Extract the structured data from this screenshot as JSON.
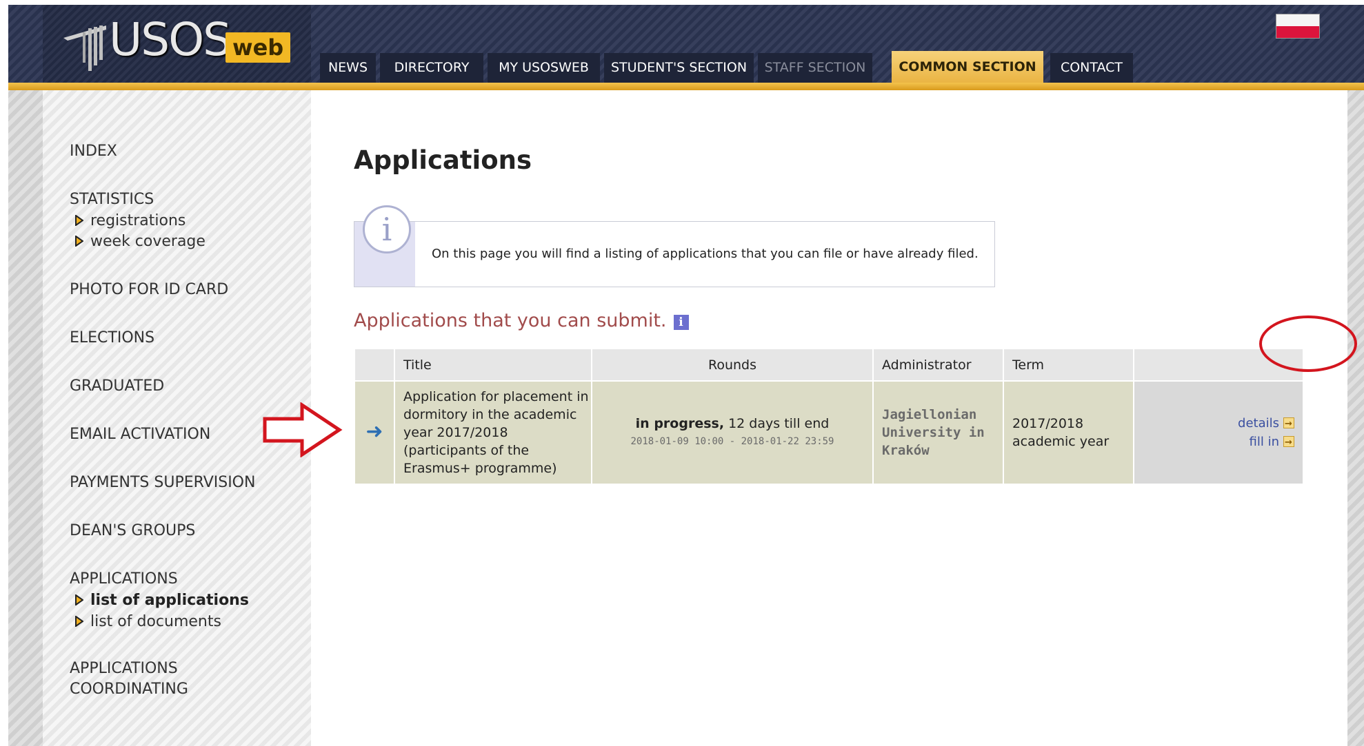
{
  "brand": {
    "logo_text": "USOS",
    "logo_badge": "web"
  },
  "header": {
    "flag": "polish-flag-icon",
    "tabs": [
      {
        "label": "NEWS",
        "state": "normal"
      },
      {
        "label": "DIRECTORY",
        "state": "normal"
      },
      {
        "label": "MY USOSWEB",
        "state": "normal"
      },
      {
        "label": "STUDENT'S SECTION",
        "state": "normal"
      },
      {
        "label": "STAFF SECTION",
        "state": "disabled"
      },
      {
        "label": "COMMON SECTION",
        "state": "active"
      },
      {
        "label": "CONTACT",
        "state": "normal"
      }
    ]
  },
  "sidebar": {
    "index": "INDEX",
    "statistics": "STATISTICS",
    "statistics_items": [
      "registrations",
      "week coverage"
    ],
    "photo": "PHOTO FOR ID CARD",
    "elections": "ELECTIONS",
    "graduated": "GRADUATED",
    "email": "EMAIL ACTIVATION",
    "payments": "PAYMENTS SUPERVISION",
    "deans": "DEAN'S GROUPS",
    "applications": "APPLICATIONS",
    "applications_items": [
      "list of applications",
      "list of documents"
    ],
    "coord_1": "APPLICATIONS",
    "coord_2": "COORDINATING"
  },
  "main": {
    "title": "Applications",
    "info_text": "On this page you will find a listing of applications that you can file or have already filed.",
    "section_title": "Applications that you can submit.",
    "table": {
      "headers": {
        "title": "Title",
        "rounds": "Rounds",
        "admin": "Administrator",
        "term": "Term"
      },
      "row": {
        "title_lines": [
          "Application for placement in",
          "dormitory in the academic",
          "year 2017/2018",
          "(participants of the",
          "Erasmus+ programme)"
        ],
        "rounds_status": "in progress,",
        "rounds_remaining": " 12 days till end",
        "rounds_dates": "2018-01-09 10:00 - 2018-01-22 23:59",
        "admin_lines": [
          "Jagiellonian",
          "University in",
          "Kraków"
        ],
        "term_lines": [
          "2017/2018",
          "academic year"
        ],
        "actions": [
          "details",
          "fill in"
        ]
      }
    }
  },
  "colors": {
    "header_bg": "#2c3553",
    "accent": "#eab443",
    "section_title": "#a14b4b",
    "row_bg": "#dcdcc6",
    "link": "#3a4fa0",
    "annotation": "#d3151e"
  }
}
